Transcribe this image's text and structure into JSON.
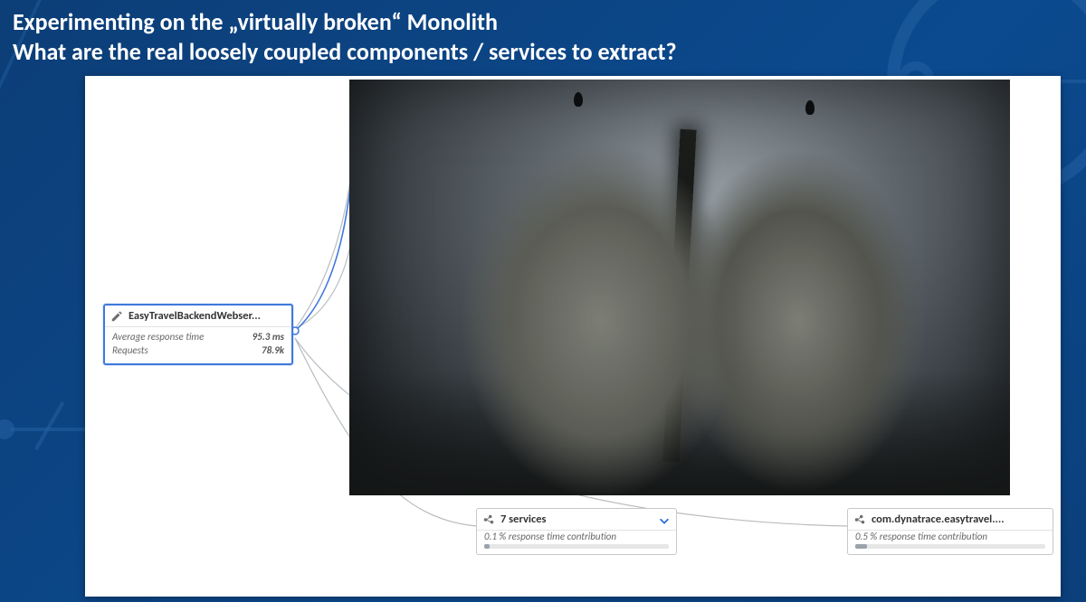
{
  "title_line1": "Experimenting on the „virtually broken“ Monolith",
  "title_line2": "What are the real loosely coupled components / services to extract?",
  "root_node": {
    "name": "EasyTravelBackendWebser...",
    "metrics": [
      {
        "label": "Average response time",
        "value": "95.3 ms"
      },
      {
        "label": "Requests",
        "value": "78.9k"
      }
    ]
  },
  "child_seven": {
    "label": "7 services",
    "contribution": "0.1 % response time contribution",
    "bar_pct": 3
  },
  "child_dynatrace": {
    "label": "com.dynatrace.easytravel....",
    "contribution": "0.5 % response time contribution",
    "bar_pct": 6
  }
}
